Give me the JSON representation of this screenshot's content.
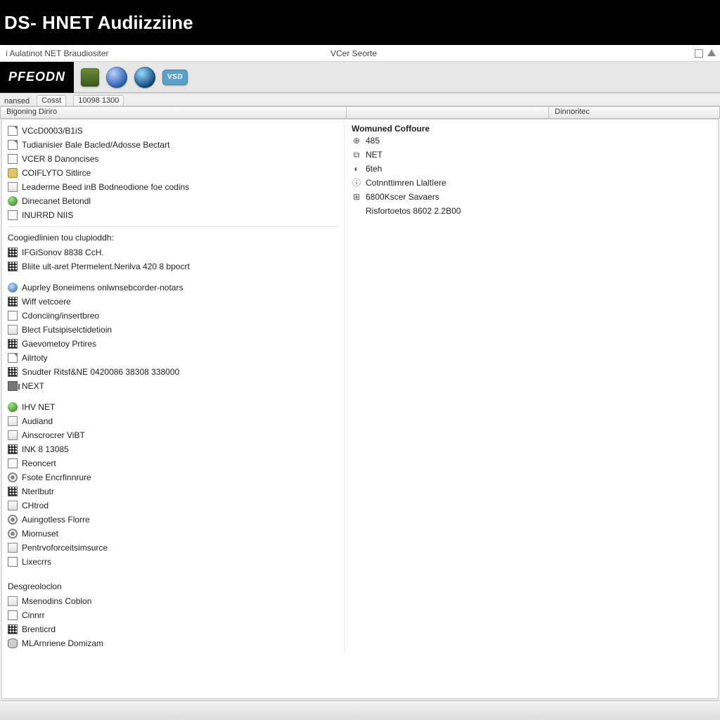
{
  "title": {
    "prefix": "DS- HNET",
    "main": "Audiizziine"
  },
  "menubar": {
    "left": "i Aulatinot NET Braudiositer",
    "mid": "VCer Seorte"
  },
  "brand": {
    "logo": "PFEODN",
    "vsd_label": "VSD"
  },
  "tabs": {
    "t1": "nansed",
    "t2": "Cosst",
    "t3": "10098 1300"
  },
  "columns": {
    "c1": "Bigoning Diriro",
    "c2": "",
    "c3": "Dinnoritec"
  },
  "tree1": [
    {
      "icon": "page",
      "label": "VCcD0003/B1iS"
    },
    {
      "icon": "page",
      "label": "Tudianisier Bale Bacled/Adosse Bectart"
    },
    {
      "icon": "box",
      "label": "VCER 8 Danoncises"
    },
    {
      "icon": "folder",
      "label": "COIFLYTO Sitlirce"
    },
    {
      "icon": "card",
      "label": "Leaderme Beed inB Bodneodione foe codins"
    },
    {
      "icon": "green",
      "label": "Dinecanet Betondl"
    },
    {
      "icon": "box",
      "label": "INURRD NIIS"
    }
  ],
  "tree2_title": "Coogiedlinien tou clupioddh:",
  "tree2": [
    {
      "icon": "grid",
      "label": "IFGiSonov 8838 CcH."
    },
    {
      "icon": "grid",
      "label": "Bliite ult-aret Ptermelent.Nerilva 420 8 bpocrt"
    }
  ],
  "tree3": [
    {
      "icon": "net",
      "label": "Auprley Boneimens onlwnsebcorder-notars"
    },
    {
      "icon": "grid",
      "label": "Wiff vetcoere"
    },
    {
      "icon": "box",
      "label": "Cdonciing/insertbreo"
    },
    {
      "icon": "card",
      "label": "Blect Futsipiselctidetioin"
    },
    {
      "icon": "grid",
      "label": "Gaevometoy Prtires"
    },
    {
      "icon": "page",
      "label": "Ailrtoty"
    },
    {
      "icon": "grid",
      "label": "Snudter Ritsf&NE 0420086 38308 338000"
    },
    {
      "icon": "chip",
      "label": "NEXT"
    }
  ],
  "tree4": [
    {
      "icon": "green",
      "label": "IHV NET"
    },
    {
      "icon": "card",
      "label": "Audiand"
    },
    {
      "icon": "card",
      "label": "Ainscrocrer ViBT"
    },
    {
      "icon": "grid",
      "label": "INK 8 13085"
    },
    {
      "icon": "box",
      "label": "Reoncert"
    },
    {
      "icon": "gear",
      "label": "Fsote Encrfinnrure"
    },
    {
      "icon": "grid",
      "label": "Nterlbutr"
    },
    {
      "icon": "card",
      "label": "CHtrod"
    },
    {
      "icon": "gear",
      "label": "Auingotless Florre"
    },
    {
      "icon": "gear",
      "label": "Miomuset"
    },
    {
      "icon": "card",
      "label": "Pentrvoforceitsimsurce"
    },
    {
      "icon": "box",
      "label": "Lixecrrs"
    }
  ],
  "tree5_title": "Desgreoloclon",
  "tree5": [
    {
      "icon": "card",
      "label": "Msenodins Coblon"
    },
    {
      "icon": "box",
      "label": "Cinnrr"
    },
    {
      "icon": "grid",
      "label": "Brenticrd"
    },
    {
      "icon": "db",
      "label": "MLArnriene Domizam"
    }
  ],
  "right": {
    "title": "Womuned Coffoure",
    "rows": [
      {
        "sym": "⊕",
        "label": "485"
      },
      {
        "sym": "⧉",
        "label": "NET"
      },
      {
        "sym": "◐",
        "label": "6teh"
      },
      {
        "sym": "ⓘ",
        "label": "Cotnnttimren Llaltîere"
      },
      {
        "sym": "⊞",
        "label": "6800Kscer Savaers"
      },
      {
        "sym": "",
        "label": "Risfortoetos 8602 2.2B00"
      }
    ]
  }
}
